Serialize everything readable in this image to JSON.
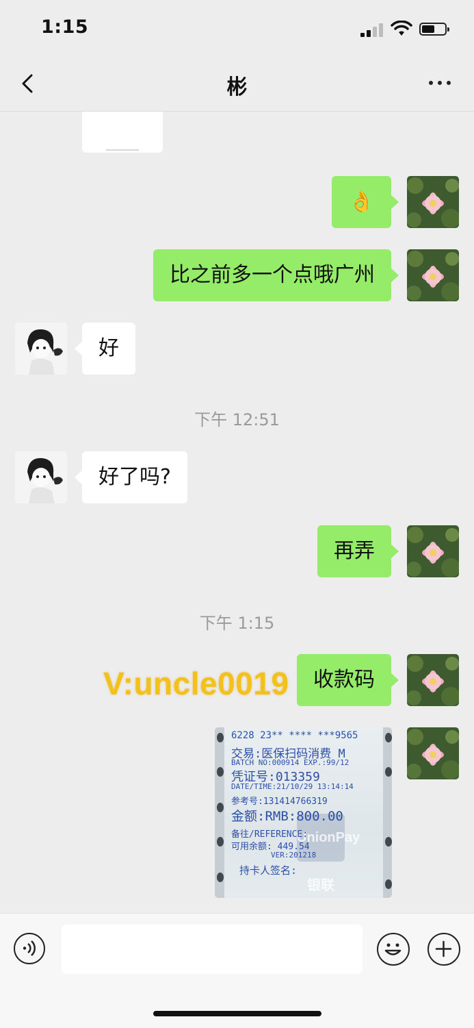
{
  "status_bar": {
    "time": "1:15"
  },
  "header": {
    "title": "彬"
  },
  "messages": [
    {
      "side": "me",
      "text": "👌"
    },
    {
      "side": "me",
      "text": "比之前多一个点哦广州"
    },
    {
      "side": "other",
      "text": "好"
    },
    {
      "side": "other",
      "text": "好了吗?"
    },
    {
      "side": "me",
      "text": "再弄"
    },
    {
      "side": "me",
      "text": "收款码"
    }
  ],
  "timestamps": [
    "下午 12:51",
    "下午 1:15"
  ],
  "overlay_text": "V:uncle0019",
  "receipt_lines": [
    "6228 23** **** ***9565",
    "交易:医保扫码消费 M",
    "BATCH NO:000914 EXP.:99/12",
    "凭证号:013359",
    "DATE/TIME:21/10/29 13:14:14",
    "参考号:131414766319",
    "金额:RMB:800.00",
    "备往/REFERENCE:",
    "可用余额: 449.54",
    "VER:201218",
    "持卡人签名:"
  ],
  "receipt_logo": "UnionPay 银联",
  "colors": {
    "my_bubble": "#95ec69",
    "other_bubble": "#ffffff",
    "background": "#ededed",
    "overlay_text": "#f3c21a"
  },
  "icons": [
    "back-chevron-icon",
    "more-dots-icon",
    "voice-icon",
    "emoji-icon",
    "plus-icon"
  ]
}
